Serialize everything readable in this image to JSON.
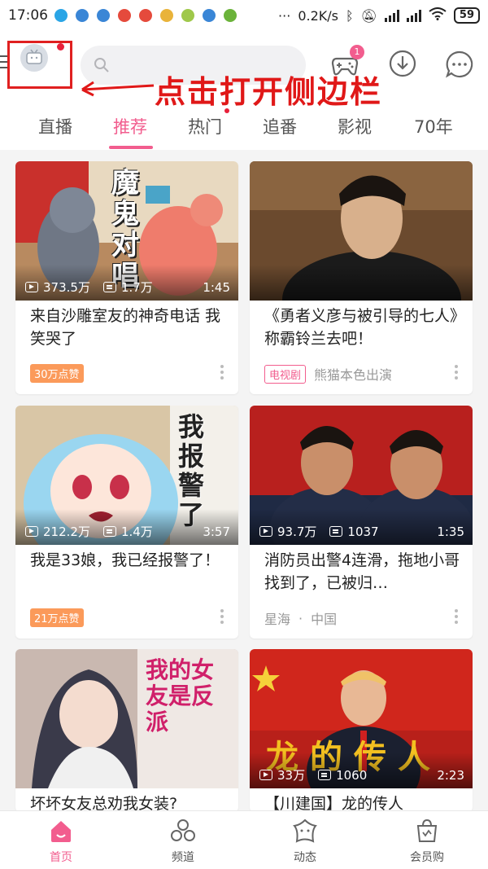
{
  "status_bar": {
    "time": "17:06",
    "dots": "···",
    "network_speed": "0.2K/s",
    "battery": "59"
  },
  "header": {
    "search_placeholder": "",
    "game_badge": "1",
    "annotation": "点击打开侧边栏"
  },
  "tabs": [
    {
      "label": "直播"
    },
    {
      "label": "推荐"
    },
    {
      "label": "热门"
    },
    {
      "label": "追番"
    },
    {
      "label": "影视"
    },
    {
      "label": "70年"
    }
  ],
  "cards": [
    {
      "thumb_text": "魔鬼对唱",
      "views": "373.5万",
      "danmaku": "1.7万",
      "duration": "1:45",
      "title": "来自沙雕室友的神奇电话 我笑哭了",
      "tag": "30万点赞"
    },
    {
      "views": "",
      "danmaku": "",
      "duration": "",
      "title": "《勇者义彦与被引导的七人》称霸铃兰去吧！",
      "tag": "电视剧",
      "author": "熊猫本色出演"
    },
    {
      "thumb_text": "我报警了",
      "views": "212.2万",
      "danmaku": "1.4万",
      "duration": "3:57",
      "title": "我是33娘，我已经报警了！",
      "tag": "21万点赞"
    },
    {
      "views": "93.7万",
      "danmaku": "1037",
      "duration": "1:35",
      "title": "消防员出警4连滑，拖地小哥找到了，已被归…",
      "author": "星海",
      "location": "中国"
    },
    {
      "thumb_text": "我的女友是反派",
      "views": "",
      "danmaku": "",
      "duration": "",
      "title": "坏坏女友总劝我女装?"
    },
    {
      "thumb_text": "龙的传人",
      "views": "33万",
      "danmaku": "1060",
      "duration": "2:23",
      "title": "【川建国】龙的传人"
    }
  ],
  "bottom_nav": [
    {
      "label": "首页",
      "icon": "home-icon"
    },
    {
      "label": "频道",
      "icon": "channel-icon"
    },
    {
      "label": "动态",
      "icon": "dynamic-icon"
    },
    {
      "label": "会员购",
      "icon": "shop-icon"
    }
  ],
  "colors": {
    "accent": "#f25d8e",
    "annotation": "#e01818",
    "tag_orange": "#fb9a5a"
  }
}
